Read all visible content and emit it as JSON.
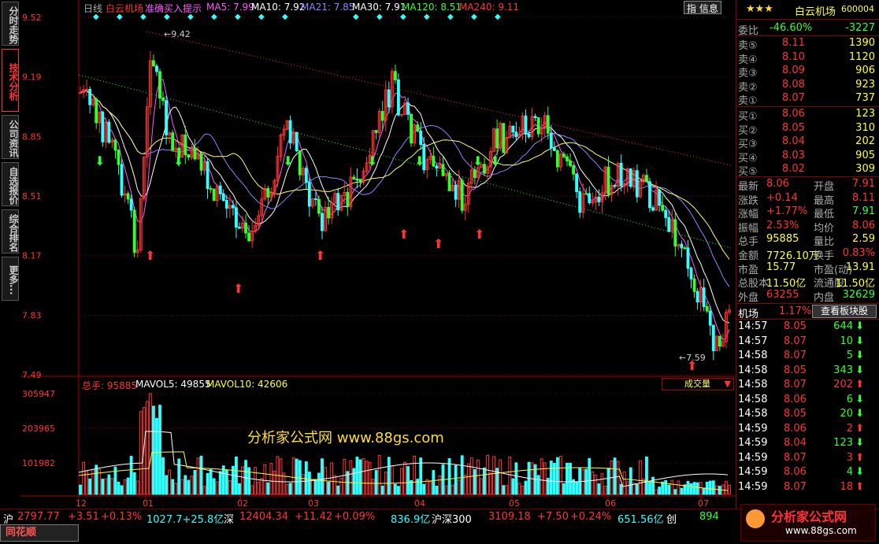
{
  "left_tabs": [
    "分时走势",
    "技术分析",
    "公司资讯",
    "自选报价",
    "综合排名",
    "更多..."
  ],
  "header": {
    "period": "日线",
    "stock": "白云机场",
    "indicator": "准确买入提示",
    "ma5": "MA5: 7.99",
    "ma10": "MA10: 7.92",
    "ma21": "MA21: 7.85",
    "ma30": "MA30: 7.91",
    "ma120": "MA120: 8.51",
    "ma240": "MA240: 9.11",
    "info_button": "指 信息"
  },
  "price_axis": [
    "9.52",
    "9.19",
    "8.85",
    "8.51",
    "8.17",
    "7.83",
    "7.49"
  ],
  "volume_axis": [
    "305947",
    "203965",
    "101982"
  ],
  "date_axis": [
    "12",
    "01",
    "02",
    "03",
    "04",
    "05",
    "06",
    "07"
  ],
  "annotations": {
    "high": "9.42",
    "low": "7.59"
  },
  "volume_header": {
    "total": "总手: 95885",
    "mavol5": "MAVOL5: 49855",
    "mavol10": "MAVOL10: 42606",
    "dropdown": "成交量"
  },
  "watermark": "分析家公式网 www.88gs.com",
  "quote": {
    "title": "白云机场",
    "code": "600004",
    "webi_label": "委比",
    "webi_pct": "-46.60%",
    "webi_diff": "-3227",
    "asks": [
      {
        "label": "卖⑤",
        "price": "8.11",
        "vol": "1390"
      },
      {
        "label": "卖④",
        "price": "8.10",
        "vol": "1120"
      },
      {
        "label": "卖③",
        "price": "8.09",
        "vol": "906"
      },
      {
        "label": "卖②",
        "price": "8.08",
        "vol": "923"
      },
      {
        "label": "卖①",
        "price": "8.07",
        "vol": "737"
      }
    ],
    "bids": [
      {
        "label": "买①",
        "price": "8.06",
        "vol": "123"
      },
      {
        "label": "买②",
        "price": "8.05",
        "vol": "310"
      },
      {
        "label": "买③",
        "price": "8.04",
        "vol": "202"
      },
      {
        "label": "买④",
        "price": "8.03",
        "vol": "905"
      },
      {
        "label": "买⑤",
        "price": "8.02",
        "vol": "309"
      }
    ],
    "stats": [
      {
        "l1": "最新",
        "v1": "8.06",
        "l2": "开盘",
        "v2": "7.91"
      },
      {
        "l1": "涨跌",
        "v1": "+0.14",
        "l2": "最高",
        "v2": "8.11"
      },
      {
        "l1": "涨幅",
        "v1": "+1.77%",
        "l2": "最低",
        "v2": "7.91"
      },
      {
        "l1": "振幅",
        "v1": "2.53%",
        "l2": "均价",
        "v2": "8.06"
      },
      {
        "l1": "总手",
        "v1": "95885",
        "l2": "量比",
        "v2": "2.59"
      },
      {
        "l1": "金额",
        "v1": "7726.10万",
        "l2": "换手",
        "v2": "0.83%"
      },
      {
        "l1": "市盈",
        "v1": "15.77",
        "l2": "市盈(动)",
        "v2": "13.91"
      },
      {
        "l1": "总股本",
        "v1": "11.50亿",
        "l2": "流通股",
        "v2": "11.50亿"
      },
      {
        "l1": "外盘",
        "v1": "63255",
        "l2": "内盘",
        "v2": "32629"
      }
    ],
    "sector": "机场",
    "sector_pct": "1.17%",
    "sector_button": "查看板块股",
    "ticks": [
      {
        "t": "14:57",
        "p": "8.05",
        "v": "644",
        "d": "down"
      },
      {
        "t": "14:57",
        "p": "8.07",
        "v": "10",
        "d": "down"
      },
      {
        "t": "14:58",
        "p": "8.07",
        "v": "5",
        "d": "down"
      },
      {
        "t": "14:58",
        "p": "8.05",
        "v": "343",
        "d": "down"
      },
      {
        "t": "14:58",
        "p": "8.07",
        "v": "202",
        "d": "up"
      },
      {
        "t": "14:58",
        "p": "8.06",
        "v": "6",
        "d": "down"
      },
      {
        "t": "14:58",
        "p": "8.05",
        "v": "20",
        "d": "down"
      },
      {
        "t": "14:59",
        "p": "8.06",
        "v": "2",
        "d": "up"
      },
      {
        "t": "14:59",
        "p": "8.04",
        "v": "123",
        "d": "down"
      },
      {
        "t": "14:59",
        "p": "8.07",
        "v": "3",
        "d": "up"
      },
      {
        "t": "14:59",
        "p": "8.06",
        "v": "4",
        "d": "down"
      },
      {
        "t": "14:59",
        "p": "8.07",
        "v": "18",
        "d": "up"
      }
    ]
  },
  "status": {
    "sh_label": "沪",
    "sh_val": "2797.77",
    "sh_chg": "+3.51",
    "sh_pct": "+0.13%",
    "sh_amt": "1027.7+25.8亿",
    "sz_label": "深",
    "sz_val": "12404.34",
    "sz_chg": "+11.42",
    "sz_pct": "+0.09%",
    "sz_amt": "836.9亿",
    "hs_label": "沪深300",
    "hs_val": "3109.18",
    "hs_chg": "+7.50",
    "hs_pct": "+0.24%",
    "hs_amt": "651.56亿",
    "chuang_label": "创",
    "chuang_val": "894",
    "brand": "同花顺",
    "logo_text": "分析家公式网",
    "logo_url": "www.88gs.com"
  },
  "colors": {
    "up": "#ff3333",
    "down": "#33ffff",
    "bg": "#000000",
    "grid": "#8b0000"
  }
}
